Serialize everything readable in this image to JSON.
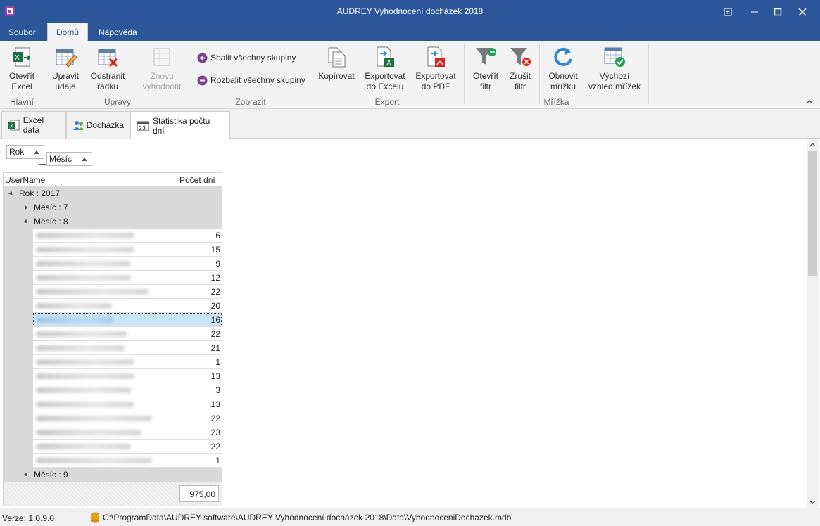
{
  "window": {
    "title": "AUDREY Vyhodnocení docházek 2018"
  },
  "menu": {
    "tabs": [
      "Soubor",
      "Domů",
      "Nápověda"
    ]
  },
  "ribbon": {
    "hlavni": {
      "label": "Hlavní",
      "open_excel": "Otevřít\nExcel"
    },
    "upravy": {
      "label": "Úpravy",
      "edit": "Upravit\núdaje",
      "remove_row": "Odstranit\nřádku",
      "reevaluate": "Znovu\nvyhodnotit"
    },
    "zobrazit": {
      "label": "Zobrazit",
      "collapse_all": "Sbalit všechny skupiny",
      "expand_all": "Rozbalit všechny skupiny"
    },
    "export": {
      "label": "Export",
      "copy": "Kopírovat",
      "to_excel": "Exportovat\ndo Excelu",
      "to_pdf": "Exportovat\ndo PDF"
    },
    "mrizka": {
      "label": "Mřížka",
      "open_filter": "Otevřít\nfiltr",
      "cancel_filter": "Zrušit\nfiltr",
      "refresh": "Obnovit\nmřížku",
      "default_view": "Výchozí\nvzhled mřížek"
    }
  },
  "doc_tabs": [
    "Excel data",
    "Docházka",
    "Statistika počtu dní"
  ],
  "grouping": {
    "chip1": "Rok",
    "chip2": "Měsíc"
  },
  "grid": {
    "columns": [
      "UserName",
      "Počet dní"
    ],
    "group_year": "Rok : 2017",
    "group_month7": "Měsíc : 7",
    "group_month8": "Měsíc : 8",
    "group_month9": "Měsíc : 9",
    "rows": [
      "6",
      "15",
      "9",
      "12",
      "22",
      "20",
      "16",
      "22",
      "21",
      "1",
      "13",
      "3",
      "13",
      "22",
      "23",
      "22",
      "1"
    ],
    "total": "975,00"
  },
  "status": {
    "version": "Verze: 1.0.9.0",
    "db_path": "C:\\ProgramData\\AUDREY software\\AUDREY Vyhodnocení docházek 2018\\Data\\VyhodnoceniDochazek.mdb"
  }
}
